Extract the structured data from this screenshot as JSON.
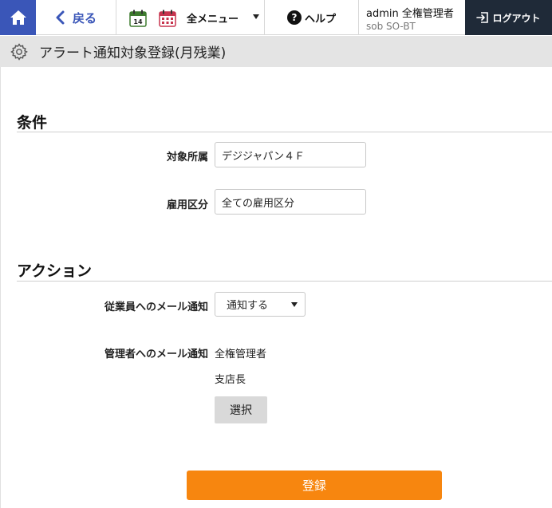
{
  "header": {
    "back_label": "戻る",
    "calendar_day": "14",
    "menu_label": "全メニュー",
    "help_label": "ヘルプ",
    "help_glyph": "?",
    "user_name": "admin 全権管理者",
    "user_sub": "sob SO-BT",
    "logout_label": "ログアウト"
  },
  "page": {
    "title": "アラート通知対象登録(月残業)"
  },
  "conditions": {
    "heading": "条件",
    "department_label": "対象所属",
    "department_value": "デジジャパン４Ｆ",
    "employment_label": "雇用区分",
    "employment_value": "全ての雇用区分"
  },
  "actions": {
    "heading": "アクション",
    "employee_mail_label": "従業員へのメール通知",
    "employee_mail_value": "通知する",
    "admin_mail_label": "管理者へのメール通知",
    "admin_recipients": [
      "全権管理者",
      "支店長"
    ],
    "select_button_label": "選択"
  },
  "footer": {
    "register_label": "登録"
  },
  "colors": {
    "brand_blue": "#3a56b8",
    "logout_bg": "#1f2a38",
    "register_orange": "#f7860f",
    "titlebar_bg": "#e4e4e4"
  },
  "icons": {
    "home": "home-icon",
    "back": "chevron-left-icon",
    "calendar": "calendar-icon",
    "calendar_grid": "calendar-grid-icon",
    "menu_caret": "caret-down-icon",
    "help": "question-circle-icon",
    "logout": "logout-icon",
    "settings": "gear-icon",
    "select_caret": "caret-down-icon"
  }
}
